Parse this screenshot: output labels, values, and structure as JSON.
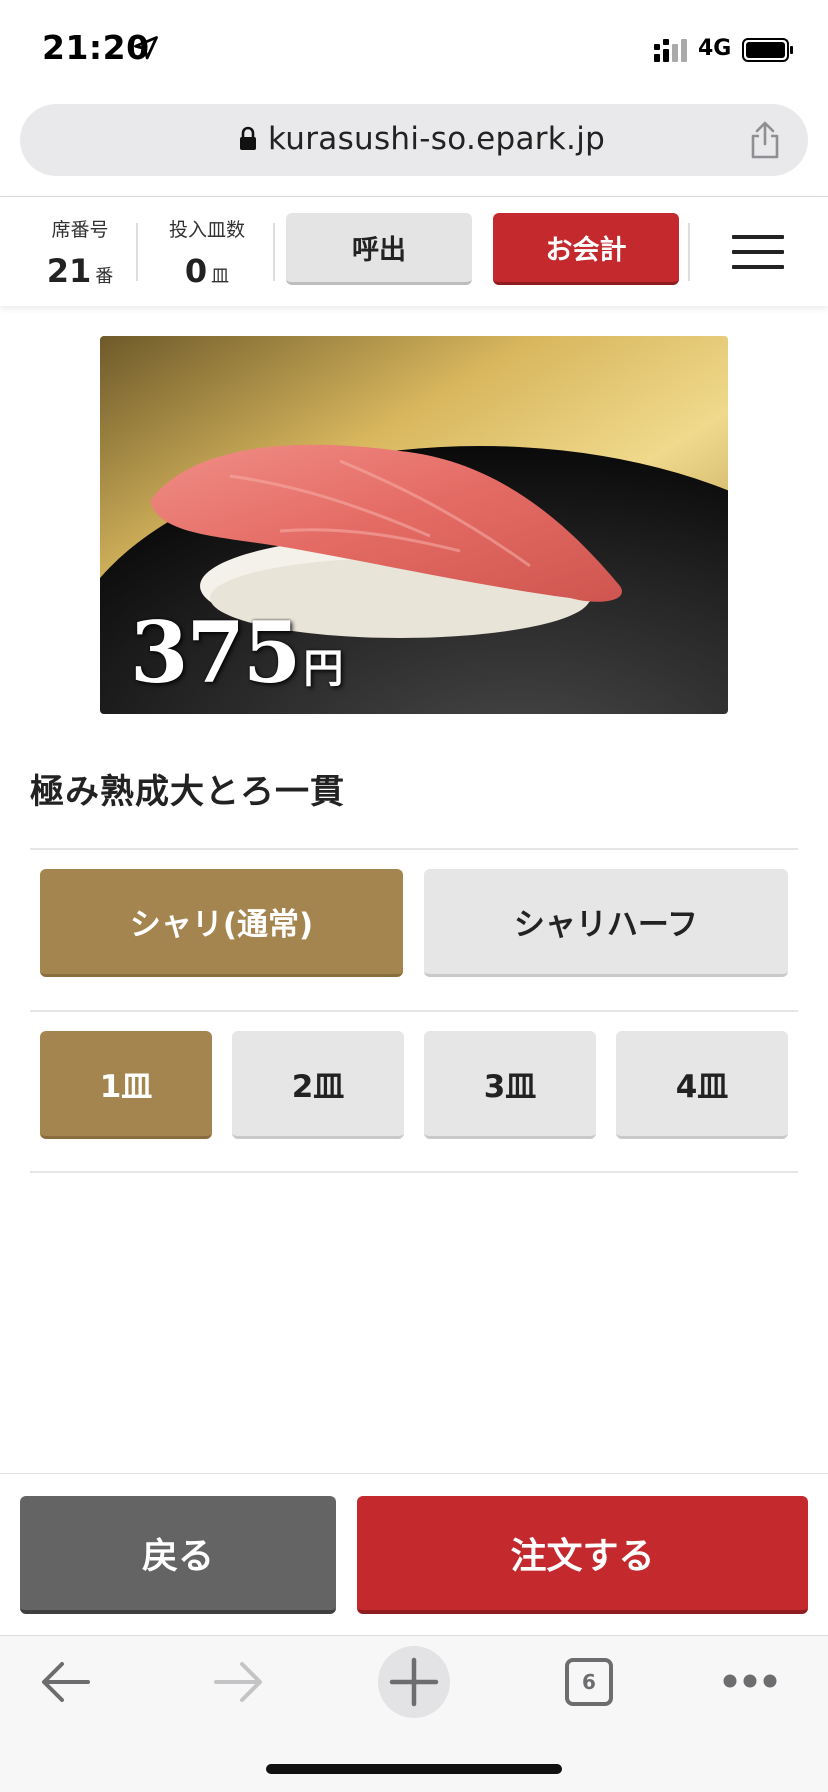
{
  "status_bar": {
    "time": "21:20",
    "network": "4G"
  },
  "browser": {
    "url": "kurasushi-so.epark.jp",
    "tab_count": "6"
  },
  "header": {
    "seat_label": "席番号",
    "seat_number": "21",
    "seat_unit": "番",
    "plates_label": "投入皿数",
    "plates_count": "0",
    "plates_unit": "皿",
    "call_label": "呼出",
    "checkout_label": "お会計"
  },
  "product": {
    "price": "375",
    "price_unit": "円",
    "name": "極み熟成大とろ一貫"
  },
  "rice_options": [
    {
      "label": "シャリ(通常)",
      "selected": true
    },
    {
      "label": "シャリハーフ",
      "selected": false
    }
  ],
  "quantity_options": [
    {
      "label": "1皿",
      "selected": true
    },
    {
      "label": "2皿",
      "selected": false
    },
    {
      "label": "3皿",
      "selected": false
    },
    {
      "label": "4皿",
      "selected": false
    }
  ],
  "actions": {
    "back_label": "戻る",
    "order_label": "注文する"
  },
  "colors": {
    "accent_red": "#c3292d",
    "selected_gold": "#a5854f",
    "back_gray": "#646464",
    "option_gray": "#e6e6e6"
  },
  "icons": [
    "location-arrow-icon",
    "signal-icon",
    "battery-icon",
    "lock-icon",
    "share-icon",
    "hamburger-menu-icon",
    "back-arrow-icon",
    "forward-arrow-icon",
    "plus-icon",
    "tabs-icon",
    "more-icon"
  ]
}
